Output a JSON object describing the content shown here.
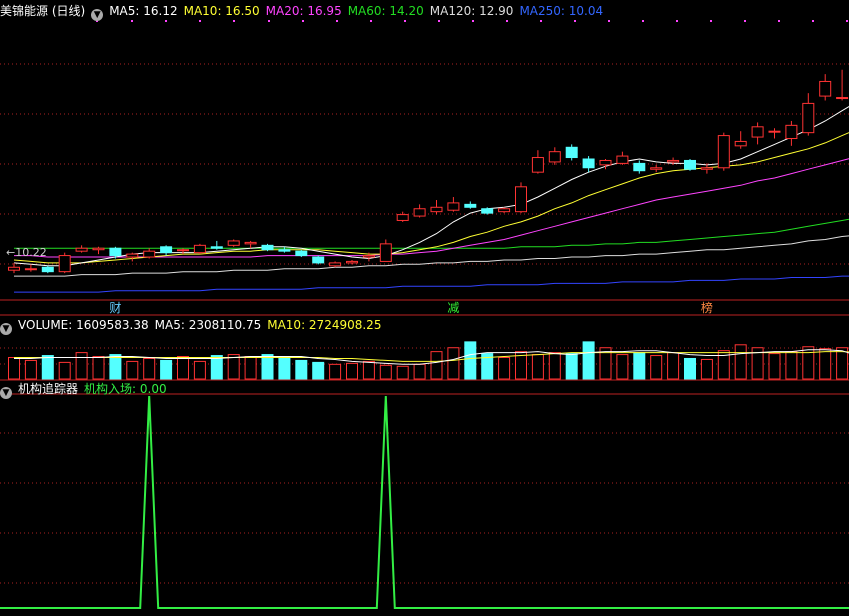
{
  "main_header": {
    "title": "美锦能源 (日线)",
    "ma5": "MA5: 16.12",
    "ma10": "MA10: 16.50",
    "ma20": "MA20: 16.95",
    "ma60": "MA60: 14.20",
    "ma120": "MA120: 12.90",
    "ma250": "MA250: 10.04"
  },
  "volume_header": {
    "volume": "VOLUME: 1609583.38",
    "ma5": "MA5: 2308110.75",
    "ma10": "MA10: 2724908.25"
  },
  "indicator_header": {
    "name": "机构追踪器",
    "value": "机构入场: 0.00"
  },
  "low_price_label": "←10.22",
  "markers": [
    {
      "text": "财",
      "candle_index": 6,
      "color": "#66ccff"
    },
    {
      "text": "减",
      "candle_index": 26,
      "color": "#33ee33"
    },
    {
      "text": "榜",
      "candle_index": 41,
      "color": "#ff8844"
    }
  ],
  "colors": {
    "up": "#ff3333",
    "down": "#54ffff",
    "ma5": "#ffffff",
    "ma10": "#ffff33",
    "ma20": "#ff44ff",
    "ma60": "#22dd22",
    "ma120": "#dddddd",
    "ma250": "#3344ff",
    "vol_ma5": "#ffffff",
    "vol_ma10": "#ffff33",
    "signal": "#33ee44",
    "grid": "#aa2222"
  },
  "chart_data": [
    {
      "type": "candlestick",
      "title": "美锦能源 (日线)",
      "ylim": [
        8.5,
        27.5
      ],
      "candles": [
        {
          "o": 10.4,
          "h": 10.9,
          "l": 10.2,
          "c": 10.6
        },
        {
          "o": 10.5,
          "h": 10.8,
          "l": 10.3,
          "c": 10.5
        },
        {
          "o": 10.6,
          "h": 10.7,
          "l": 10.2,
          "c": 10.3
        },
        {
          "o": 10.3,
          "h": 11.6,
          "l": 10.2,
          "c": 11.4
        },
        {
          "o": 11.7,
          "h": 12.1,
          "l": 11.6,
          "c": 11.9
        },
        {
          "o": 11.8,
          "h": 12.0,
          "l": 11.5,
          "c": 11.9
        },
        {
          "o": 11.9,
          "h": 12.0,
          "l": 11.2,
          "c": 11.4
        },
        {
          "o": 11.3,
          "h": 11.6,
          "l": 11.0,
          "c": 11.5
        },
        {
          "o": 11.3,
          "h": 11.9,
          "l": 11.2,
          "c": 11.7
        },
        {
          "o": 12.0,
          "h": 12.1,
          "l": 11.4,
          "c": 11.6
        },
        {
          "o": 11.8,
          "h": 11.9,
          "l": 11.5,
          "c": 11.8
        },
        {
          "o": 11.6,
          "h": 12.2,
          "l": 11.5,
          "c": 12.1
        },
        {
          "o": 12.0,
          "h": 12.4,
          "l": 11.8,
          "c": 11.9
        },
        {
          "o": 12.1,
          "h": 12.5,
          "l": 12.0,
          "c": 12.4
        },
        {
          "o": 12.2,
          "h": 12.4,
          "l": 11.9,
          "c": 12.3
        },
        {
          "o": 12.1,
          "h": 12.2,
          "l": 11.7,
          "c": 11.8
        },
        {
          "o": 11.8,
          "h": 12.0,
          "l": 11.6,
          "c": 11.7
        },
        {
          "o": 11.7,
          "h": 11.8,
          "l": 11.3,
          "c": 11.4
        },
        {
          "o": 11.3,
          "h": 11.4,
          "l": 10.8,
          "c": 10.9
        },
        {
          "o": 10.7,
          "h": 11.0,
          "l": 10.6,
          "c": 10.9
        },
        {
          "o": 10.9,
          "h": 11.1,
          "l": 10.8,
          "c": 11.0
        },
        {
          "o": 11.3,
          "h": 11.6,
          "l": 11.0,
          "c": 11.4
        },
        {
          "o": 11.0,
          "h": 12.5,
          "l": 11.0,
          "c": 12.2
        },
        {
          "o": 13.8,
          "h": 14.4,
          "l": 13.7,
          "c": 14.2
        },
        {
          "o": 14.1,
          "h": 14.9,
          "l": 14.0,
          "c": 14.6
        },
        {
          "o": 14.4,
          "h": 15.2,
          "l": 14.2,
          "c": 14.7
        },
        {
          "o": 14.5,
          "h": 15.4,
          "l": 14.4,
          "c": 15.0
        },
        {
          "o": 14.9,
          "h": 15.1,
          "l": 14.6,
          "c": 14.7
        },
        {
          "o": 14.6,
          "h": 14.7,
          "l": 14.2,
          "c": 14.3
        },
        {
          "o": 14.4,
          "h": 14.7,
          "l": 14.3,
          "c": 14.6
        },
        {
          "o": 14.4,
          "h": 16.4,
          "l": 14.3,
          "c": 16.1
        },
        {
          "o": 17.1,
          "h": 18.6,
          "l": 17.0,
          "c": 18.1
        },
        {
          "o": 17.8,
          "h": 18.8,
          "l": 17.6,
          "c": 18.5
        },
        {
          "o": 18.8,
          "h": 19.0,
          "l": 17.9,
          "c": 18.1
        },
        {
          "o": 18.0,
          "h": 18.2,
          "l": 17.1,
          "c": 17.4
        },
        {
          "o": 17.6,
          "h": 18.0,
          "l": 17.3,
          "c": 17.9
        },
        {
          "o": 17.7,
          "h": 18.5,
          "l": 17.6,
          "c": 18.2
        },
        {
          "o": 17.7,
          "h": 17.9,
          "l": 17.0,
          "c": 17.2
        },
        {
          "o": 17.3,
          "h": 17.6,
          "l": 17.1,
          "c": 17.4
        },
        {
          "o": 17.8,
          "h": 18.1,
          "l": 17.6,
          "c": 17.9
        },
        {
          "o": 17.9,
          "h": 18.0,
          "l": 17.2,
          "c": 17.3
        },
        {
          "o": 17.3,
          "h": 17.7,
          "l": 17.0,
          "c": 17.4
        },
        {
          "o": 17.4,
          "h": 19.8,
          "l": 17.2,
          "c": 19.6
        },
        {
          "o": 18.9,
          "h": 19.9,
          "l": 18.7,
          "c": 19.2
        },
        {
          "o": 19.5,
          "h": 20.5,
          "l": 19.0,
          "c": 20.2
        },
        {
          "o": 19.9,
          "h": 20.1,
          "l": 19.4,
          "c": 19.9
        },
        {
          "o": 19.4,
          "h": 20.6,
          "l": 18.9,
          "c": 20.3
        },
        {
          "o": 19.8,
          "h": 22.5,
          "l": 19.6,
          "c": 21.8
        },
        {
          "o": 22.3,
          "h": 23.8,
          "l": 22.0,
          "c": 23.3
        },
        {
          "o": 22.2,
          "h": 24.1,
          "l": 22.0,
          "c": 22.2
        },
        {
          "o": 22.9,
          "h": 24.4,
          "l": 22.6,
          "c": 24.1
        }
      ],
      "ma": {
        "ma5": [
          10.9,
          10.8,
          10.7,
          10.7,
          10.9,
          11.1,
          11.3,
          11.5,
          11.6,
          11.6,
          11.6,
          11.6,
          11.7,
          11.8,
          11.9,
          12.0,
          12.0,
          11.9,
          11.7,
          11.5,
          11.3,
          11.2,
          11.4,
          11.8,
          12.3,
          12.9,
          13.7,
          14.3,
          14.6,
          14.7,
          14.9,
          15.4,
          16.0,
          16.6,
          17.1,
          17.5,
          17.8,
          18.0,
          17.8,
          17.7,
          17.7,
          17.6,
          17.7,
          18.0,
          18.5,
          19.0,
          19.5,
          20.0,
          20.6,
          21.3,
          22.0
        ],
        "ma10": [
          11.1,
          11.0,
          10.9,
          10.9,
          10.9,
          11.0,
          11.1,
          11.2,
          11.3,
          11.4,
          11.5,
          11.5,
          11.6,
          11.7,
          11.7,
          11.8,
          11.8,
          11.8,
          11.8,
          11.7,
          11.6,
          11.5,
          11.5,
          11.6,
          11.8,
          12.0,
          12.3,
          12.7,
          13.0,
          13.4,
          13.7,
          14.1,
          14.6,
          15.0,
          15.5,
          15.9,
          16.3,
          16.7,
          17.0,
          17.2,
          17.3,
          17.4,
          17.5,
          17.6,
          17.8,
          18.1,
          18.4,
          18.7,
          19.1,
          19.6,
          20.1
        ],
        "ma20": [
          11.4,
          11.4,
          11.3,
          11.3,
          11.3,
          11.3,
          11.3,
          11.3,
          11.3,
          11.3,
          11.3,
          11.3,
          11.3,
          11.3,
          11.3,
          11.4,
          11.4,
          11.4,
          11.4,
          11.4,
          11.4,
          11.4,
          11.5,
          11.5,
          11.6,
          11.7,
          11.9,
          12.1,
          12.3,
          12.5,
          12.8,
          13.1,
          13.4,
          13.7,
          14.0,
          14.3,
          14.6,
          14.9,
          15.2,
          15.4,
          15.6,
          15.8,
          16.0,
          16.2,
          16.5,
          16.7,
          17.0,
          17.3,
          17.6,
          17.9,
          18.2
        ],
        "ma60": [
          11.9,
          11.9,
          11.9,
          11.9,
          11.9,
          11.9,
          11.9,
          11.9,
          11.9,
          11.9,
          11.9,
          11.9,
          11.9,
          11.9,
          11.9,
          11.9,
          11.9,
          11.9,
          11.9,
          11.9,
          11.9,
          11.9,
          11.9,
          11.9,
          11.9,
          11.9,
          11.9,
          11.9,
          11.9,
          11.9,
          12.0,
          12.0,
          12.0,
          12.1,
          12.1,
          12.2,
          12.2,
          12.3,
          12.3,
          12.4,
          12.5,
          12.6,
          12.7,
          12.8,
          12.9,
          13.0,
          13.2,
          13.4,
          13.6,
          13.8,
          14.0
        ],
        "ma120": [
          10.0,
          10.0,
          10.0,
          10.0,
          10.1,
          10.1,
          10.1,
          10.2,
          10.2,
          10.2,
          10.3,
          10.3,
          10.3,
          10.4,
          10.4,
          10.4,
          10.5,
          10.5,
          10.5,
          10.6,
          10.6,
          10.7,
          10.7,
          10.8,
          10.8,
          10.9,
          10.9,
          11.0,
          11.0,
          11.1,
          11.1,
          11.2,
          11.2,
          11.3,
          11.3,
          11.4,
          11.4,
          11.5,
          11.5,
          11.6,
          11.7,
          11.8,
          11.8,
          11.9,
          12.0,
          12.1,
          12.2,
          12.4,
          12.5,
          12.7,
          12.8
        ],
        "ma250": [
          8.9,
          8.9,
          8.9,
          8.9,
          8.9,
          8.9,
          9.0,
          9.0,
          9.0,
          9.0,
          9.0,
          9.0,
          9.1,
          9.1,
          9.1,
          9.1,
          9.1,
          9.1,
          9.2,
          9.2,
          9.2,
          9.2,
          9.2,
          9.3,
          9.3,
          9.3,
          9.3,
          9.3,
          9.4,
          9.4,
          9.4,
          9.4,
          9.5,
          9.5,
          9.5,
          9.5,
          9.6,
          9.6,
          9.6,
          9.6,
          9.7,
          9.7,
          9.7,
          9.8,
          9.8,
          9.8,
          9.9,
          9.9,
          9.9,
          10.0,
          10.0
        ]
      }
    },
    {
      "type": "bar",
      "title": "VOLUME",
      "ylim": [
        0,
        4400000
      ],
      "values": [
        2200000,
        1900000,
        2400000,
        1700000,
        2700000,
        2300000,
        2500000,
        1800000,
        2100000,
        1900000,
        2300000,
        1800000,
        2400000,
        2500000,
        2300000,
        2500000,
        2200000,
        1900000,
        1700000,
        1500000,
        1600000,
        1800000,
        1400000,
        1300000,
        1500000,
        2800000,
        3200000,
        3800000,
        2600000,
        2200000,
        2800000,
        2500000,
        2700000,
        2600000,
        3800000,
        3200000,
        2500000,
        2700000,
        2400000,
        2700000,
        2100000,
        2000000,
        2900000,
        3500000,
        3200000,
        2600000,
        2800000,
        3300000,
        3100000,
        3200000,
        1609583.38
      ],
      "ma5": [
        2100000,
        2100000,
        2200000,
        2200000,
        2200000,
        2200000,
        2300000,
        2300000,
        2200000,
        2100000,
        2100000,
        2100000,
        2100000,
        2200000,
        2300000,
        2300000,
        2300000,
        2300000,
        2100000,
        2000000,
        1800000,
        1700000,
        1600000,
        1500000,
        1500000,
        1700000,
        2000000,
        2500000,
        2700000,
        2700000,
        2700000,
        2800000,
        2600000,
        2500000,
        2700000,
        2800000,
        2800000,
        2900000,
        2900000,
        2700000,
        2500000,
        2400000,
        2400000,
        2600000,
        2700000,
        2800000,
        2800000,
        3000000,
        3000000,
        2900000,
        2308110.75
      ],
      "ma10": [
        2200000,
        2200000,
        2200000,
        2200000,
        2200000,
        2200000,
        2200000,
        2200000,
        2200000,
        2200000,
        2200000,
        2200000,
        2200000,
        2200000,
        2200000,
        2200000,
        2200000,
        2200000,
        2200000,
        2100000,
        2100000,
        2000000,
        1900000,
        1800000,
        1800000,
        1800000,
        1900000,
        2100000,
        2200000,
        2300000,
        2400000,
        2500000,
        2600000,
        2700000,
        2700000,
        2700000,
        2700000,
        2700000,
        2700000,
        2700000,
        2700000,
        2700000,
        2700000,
        2700000,
        2700000,
        2700000,
        2700000,
        2700000,
        2800000,
        2800000,
        2724908.25
      ]
    },
    {
      "type": "line",
      "title": "机构追踪器",
      "series": [
        {
          "name": "机构入场",
          "values": [
            0,
            0,
            0,
            0,
            0,
            0,
            0,
            0,
            1,
            0,
            0,
            0,
            0,
            0,
            0,
            0,
            0,
            0,
            0,
            0,
            0,
            0,
            1,
            0,
            0,
            0,
            0,
            0,
            0,
            0,
            0,
            0,
            0,
            0,
            0,
            0,
            0,
            0,
            0,
            0,
            0,
            0,
            0,
            0,
            0,
            0,
            0,
            0,
            0,
            0,
            0
          ]
        }
      ],
      "ylim": [
        0,
        1
      ]
    }
  ]
}
